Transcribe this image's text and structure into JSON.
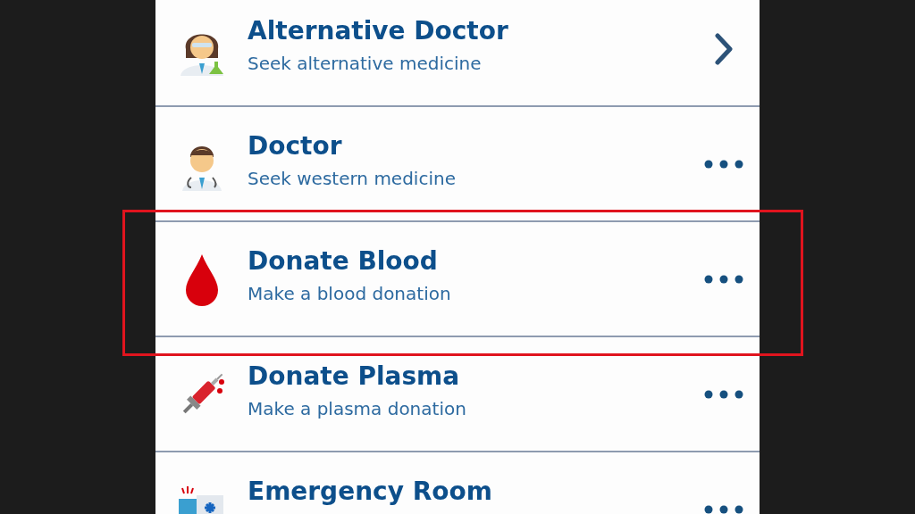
{
  "items": [
    {
      "title": "Alternative Doctor",
      "subtitle": "Seek alternative medicine",
      "kind": "chevron",
      "highlighted": false
    },
    {
      "title": "Doctor",
      "subtitle": "Seek western medicine",
      "kind": "more",
      "highlighted": false
    },
    {
      "title": "Donate Blood",
      "subtitle": "Make a blood donation",
      "kind": "more",
      "highlighted": true
    },
    {
      "title": "Donate Plasma",
      "subtitle": "Make a plasma donation",
      "kind": "more",
      "highlighted": false
    },
    {
      "title": "Emergency Room",
      "kind": "more",
      "highlighted": false
    }
  ]
}
